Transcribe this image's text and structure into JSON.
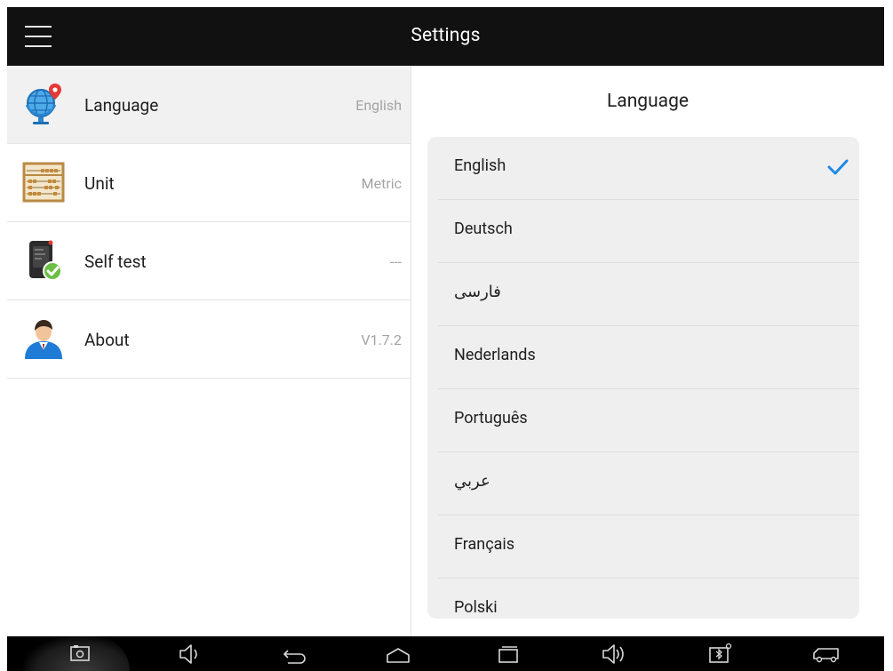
{
  "app_bar": {
    "title": "Settings",
    "menu_icon": "hamburger-menu-icon"
  },
  "settings": {
    "items": [
      {
        "label": "Language",
        "value": "English",
        "icon": "globe-location-icon",
        "active": true
      },
      {
        "label": "Unit",
        "value": "Metric",
        "icon": "abacus-icon",
        "active": false
      },
      {
        "label": "Self test",
        "value": "---",
        "icon": "device-check-icon",
        "active": false
      },
      {
        "label": "About",
        "value": "V1.7.2",
        "icon": "user-avatar-icon",
        "active": false
      }
    ]
  },
  "language_panel": {
    "heading": "Language",
    "selected": "English",
    "options": [
      {
        "label": "English"
      },
      {
        "label": "Deutsch"
      },
      {
        "label": "فارسی"
      },
      {
        "label": "Nederlands"
      },
      {
        "label": "Português"
      },
      {
        "label": "عربي"
      },
      {
        "label": "Français"
      },
      {
        "label": "Polski"
      }
    ]
  },
  "system_bar": {
    "buttons": [
      "screenshot-icon",
      "volume-down-icon",
      "back-icon",
      "home-icon",
      "recent-apps-icon",
      "volume-up-icon",
      "bluetooth-device-icon",
      "vehicle-icon"
    ]
  },
  "colors": {
    "app_bar_bg": "#111111",
    "accent_check": "#1e88e5",
    "active_row_bg": "#f1f1f1",
    "card_bg": "#efefef"
  }
}
